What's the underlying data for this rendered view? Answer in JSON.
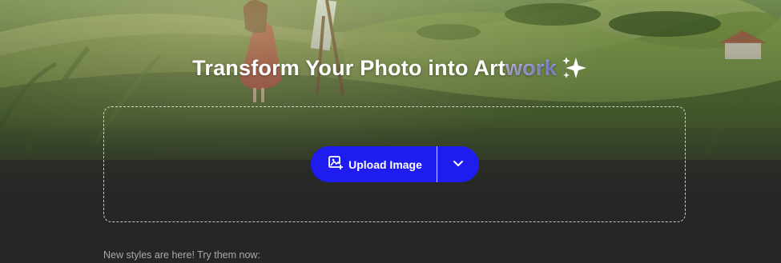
{
  "hero": {
    "title_main": "Transform Your Photo into Art",
    "title_accent": "work",
    "sparkle_icon": "sparkle-icon"
  },
  "uploader": {
    "upload_label": "Upload Image",
    "upload_icon": "image-add-icon",
    "dropdown_icon": "chevron-down-icon"
  },
  "styles_section": {
    "note": "New styles are here! Try them now:"
  },
  "colors": {
    "accent_button": "#1f1cf0",
    "background": "#262626",
    "title_accent_start": "#d7cdfb",
    "title_accent_end": "#9aa4ff"
  }
}
